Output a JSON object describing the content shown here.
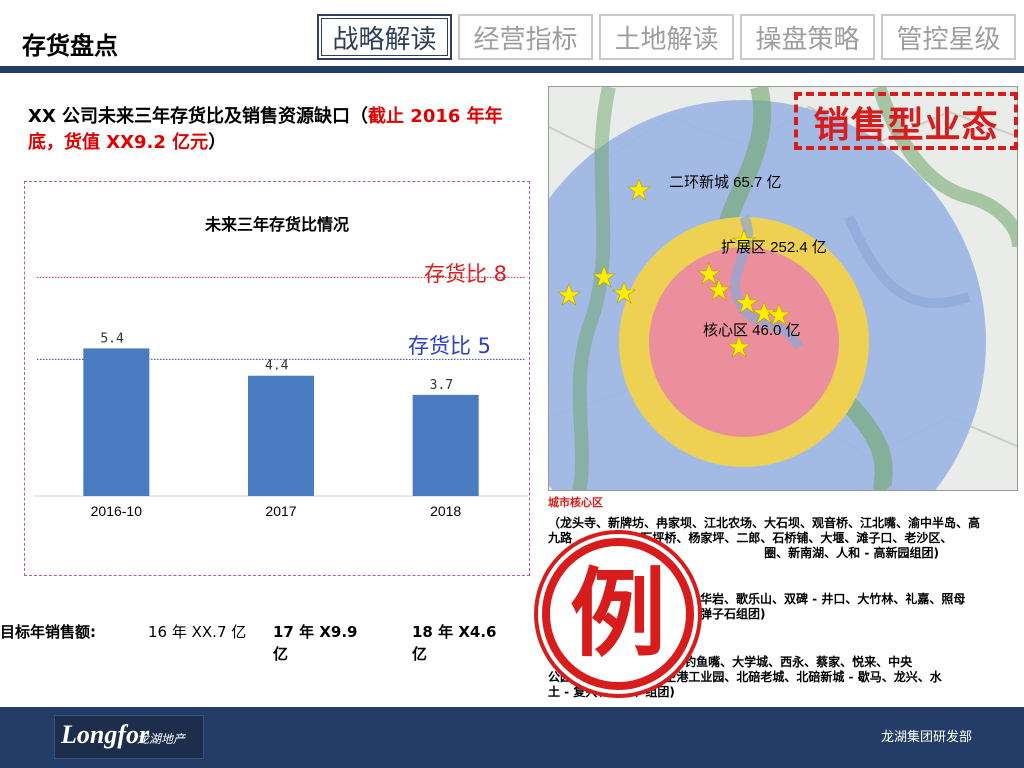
{
  "page": {
    "title": "存货盘点"
  },
  "tabs": [
    {
      "label": "战略解读",
      "active": true
    },
    {
      "label": "经营指标",
      "active": false
    },
    {
      "label": "土地解读",
      "active": false
    },
    {
      "label": "操盘策略",
      "active": false
    },
    {
      "label": "管控星级",
      "active": false
    }
  ],
  "heading": {
    "black": "XX 公司未来三年存货比及销售资源缺口（",
    "red": "截止 2016 年年底，货值 XX9.2 亿元",
    "close": "）"
  },
  "chart_data": {
    "type": "bar",
    "title": "未来三年存货比情况",
    "categories": [
      "2016-10",
      "2017",
      "2018"
    ],
    "values": [
      5.4,
      4.4,
      3.7
    ],
    "value_labels": [
      "5.4",
      "4.4",
      "3.7"
    ],
    "ylim": [
      0,
      9
    ],
    "bar_color": "#4a7abf",
    "reference_lines": [
      {
        "value": 8,
        "label": "存货比 8",
        "color": "#e02020"
      },
      {
        "value": 5,
        "label": "存货比 5",
        "color": "#2c3fc8"
      }
    ]
  },
  "sales": {
    "label": "目标年销售额:",
    "items": [
      "16 年 XX.7 亿",
      "17 年 X9.9 亿",
      "18 年 X4.6 亿"
    ]
  },
  "map": {
    "ring_labels": [
      "二环新城 65.7 亿",
      "扩展区 252.4 亿",
      "核心区 46.0 亿"
    ],
    "colors": {
      "outer_ring": "#9bb6e3",
      "middle_ring": "#f2d24b",
      "core": "#ec8f9d",
      "star": "#ffee00"
    }
  },
  "type_badge": "销售型业态",
  "districts": {
    "title": "城市核心区",
    "lines": [
      "（龙头寺、新牌坊、冉家坝、江北农场、大石坝、观音桥、江北嘴、渝中半岛、高",
      "九路 　　　　　 石坪桥、杨家坪、二郎、石桥铺、大堰、滩子口、老沙区、",
      "　　　　　　　 圈、新南湖、人和 - 高新园组团)",
      "圈、华岩、歌乐山、双碑 - 井口、大竹林、礼嘉、照母",
      "滩、弹子石组团)",
      "　　　　　 州湾、鱼洞、钓鱼嘴、大学城、西永、蔡家、悦来、中央",
      "公园 　　　　 回兴、空港工业园、北碚老城、北碚新城 - 歇马、龙兴、水",
      "土 - 复兴、西彭、组团)"
    ]
  },
  "stamp": "例",
  "footer": {
    "logo": "Longfor",
    "logo_sub": "龙湖地产",
    "dept": "龙湖集团研发部"
  }
}
